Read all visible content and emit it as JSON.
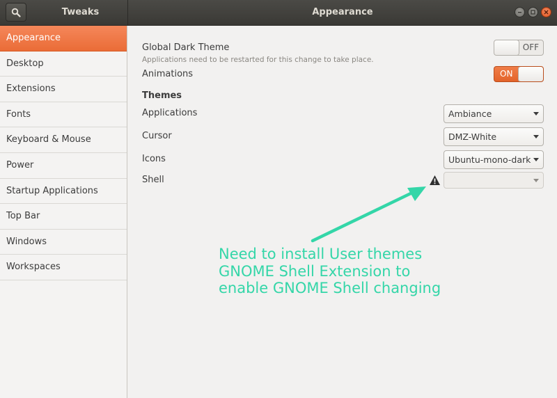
{
  "titlebar": {
    "app_title": "Tweaks",
    "page_title": "Appearance",
    "search_icon": "magnifier-icon",
    "buttons": [
      "minimize",
      "maximize",
      "close"
    ]
  },
  "sidebar": {
    "items": [
      {
        "label": "Appearance",
        "selected": true
      },
      {
        "label": "Desktop"
      },
      {
        "label": "Extensions"
      },
      {
        "label": "Fonts"
      },
      {
        "label": "Keyboard & Mouse"
      },
      {
        "label": "Power"
      },
      {
        "label": "Startup Applications"
      },
      {
        "label": "Top Bar"
      },
      {
        "label": "Windows"
      },
      {
        "label": "Workspaces"
      }
    ]
  },
  "appearance": {
    "global_dark": {
      "label": "Global Dark Theme",
      "sublabel": "Applications need to be restarted for this change to take place.",
      "state": "OFF"
    },
    "animations": {
      "label": "Animations",
      "state": "ON"
    },
    "themes_header": "Themes",
    "applications": {
      "label": "Applications",
      "value": "Ambiance"
    },
    "cursor": {
      "label": "Cursor",
      "value": "DMZ-White"
    },
    "icons": {
      "label": "Icons",
      "value": "Ubuntu-mono-dark"
    },
    "shell": {
      "label": "Shell",
      "value": "",
      "warning_icon": "warning-triangle-icon"
    }
  },
  "annotation": {
    "lines": [
      "Need to install User themes",
      "GNOME Shell Extension to",
      "enable GNOME Shell changing"
    ],
    "color": "#34d6a8"
  },
  "colors": {
    "accent": "#e9662f",
    "titlebar": "#3f3e3a",
    "annotation": "#34d6a8"
  }
}
